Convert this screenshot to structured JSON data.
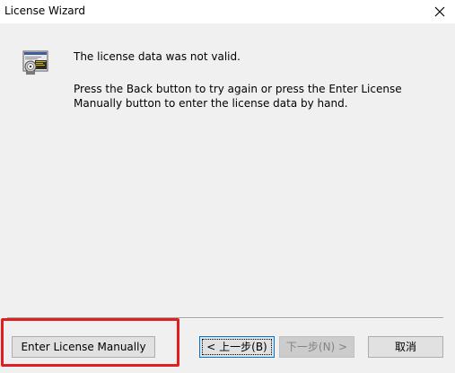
{
  "window": {
    "title": "License Wizard",
    "close_icon": "close-icon"
  },
  "content": {
    "icon": "license-certificate-icon",
    "message_primary": "The license data was not valid.",
    "message_secondary": "Press the Back button to try again or press the Enter License Manually button to enter the license data by hand."
  },
  "buttons": {
    "enter_manually": "Enter License Manually",
    "back": "< 上一步(B)",
    "next": "下一步(N) >",
    "cancel": "取消"
  },
  "colors": {
    "dialog_bg": "#f0f0f0",
    "titlebar_bg": "#ffffff",
    "focus_border": "#0078d7",
    "highlight_annotation": "#e02020"
  }
}
